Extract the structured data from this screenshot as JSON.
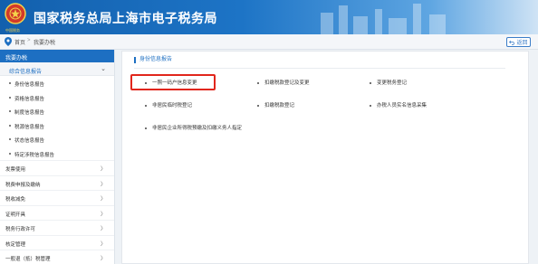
{
  "header": {
    "emblem_caption": "中国税务",
    "title": "国家税务总局上海市电子税务局"
  },
  "breadcrumb": {
    "items": [
      "首页",
      "我要办税"
    ],
    "separator": ">",
    "back_label": "返回"
  },
  "sidebar": {
    "title": "我要办税",
    "group": {
      "label": "综合信息报告",
      "caret": "⌄"
    },
    "sub_items": [
      "身份信息报告",
      "资格信息报告",
      "制度信息报告",
      "税源信息报告",
      "状态信息报告",
      "特定涉税信息报告"
    ],
    "menu_items": [
      "发票使用",
      "税费申报及缴纳",
      "税收减免",
      "证明开具",
      "税务行政许可",
      "核定管理",
      "一般退（抵）税管理"
    ]
  },
  "main": {
    "section_title": "身份信息报告",
    "links": [
      "一照一码户信息变更",
      "扣缴税款登记及变更",
      "变更税务登记",
      "非居民临时税登记",
      "扣缴税款登记",
      "办税人员实名信息采集",
      "非居民企业所得税预缴及扣缴义务人指定"
    ]
  },
  "colors": {
    "brand_blue": "#1d6fc2",
    "highlight_red": "#e1261c"
  }
}
